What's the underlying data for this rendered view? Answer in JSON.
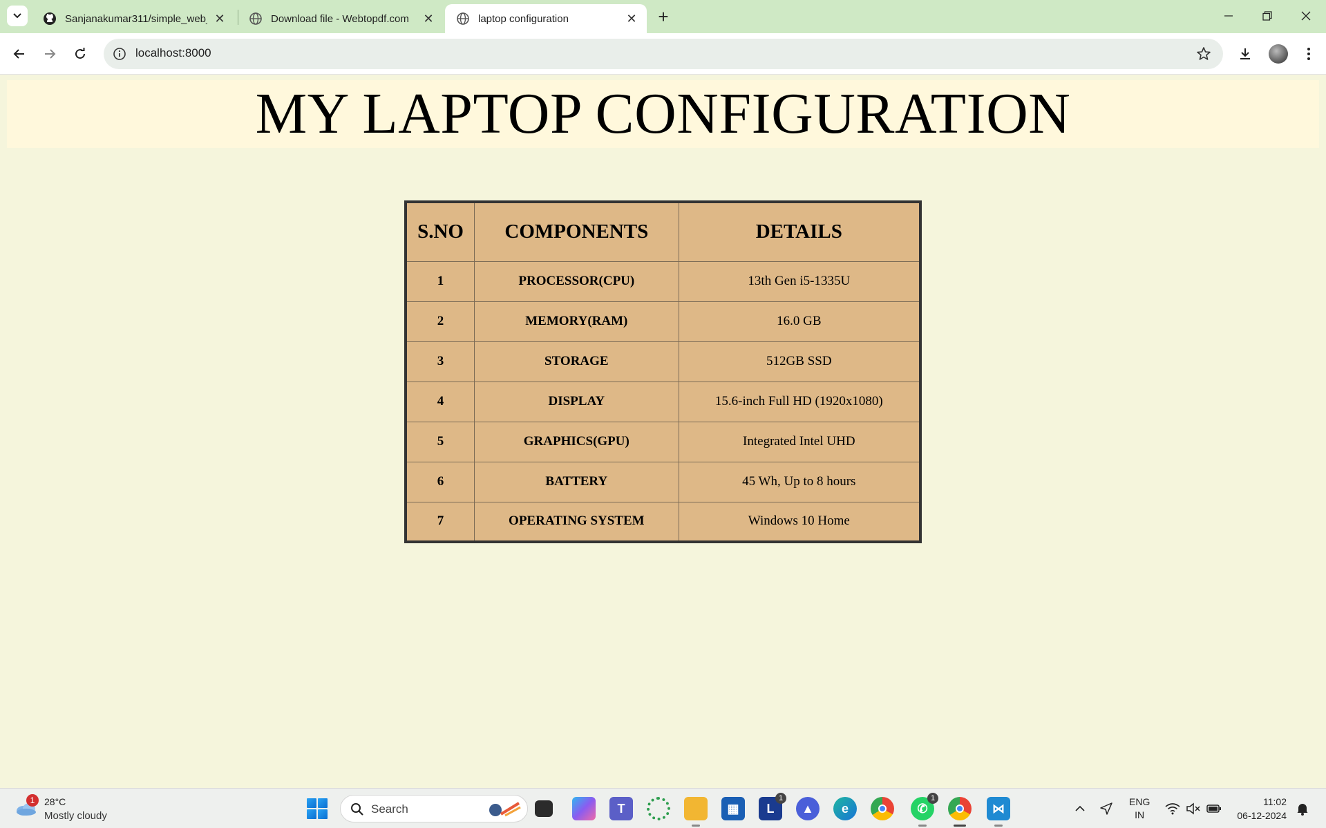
{
  "browser": {
    "tabs": [
      {
        "title": "Sanjanakumar311/simple_web_",
        "favicon": "github-icon"
      },
      {
        "title": "Download file - Webtopdf.com",
        "favicon": "globe-icon"
      },
      {
        "title": "laptop configuration",
        "favicon": "globe-icon",
        "active": true
      }
    ],
    "address": "localhost:8000"
  },
  "page": {
    "heading": "MY LAPTOP CONFIGURATION",
    "table": {
      "headers": [
        "S.NO",
        "COMPONENTS",
        "DETAILS"
      ],
      "rows": [
        {
          "sno": "1",
          "component": "PROCESSOR(CPU)",
          "details": "13th Gen i5-1335U"
        },
        {
          "sno": "2",
          "component": "MEMORY(RAM)",
          "details": "16.0 GB"
        },
        {
          "sno": "3",
          "component": "STORAGE",
          "details": "512GB SSD"
        },
        {
          "sno": "4",
          "component": "DISPLAY",
          "details": "15.6-inch Full HD (1920x1080)"
        },
        {
          "sno": "5",
          "component": "GRAPHICS(GPU)",
          "details": "Integrated Intel UHD"
        },
        {
          "sno": "6",
          "component": "BATTERY",
          "details": "45 Wh, Up to 8 hours"
        },
        {
          "sno": "7",
          "component": "OPERATING SYSTEM",
          "details": "Windows 10 Home"
        }
      ]
    }
  },
  "taskbar": {
    "weather": {
      "badge": "1",
      "temp": "28°C",
      "condition": "Mostly cloudy"
    },
    "search_label": "Search",
    "apps": [
      {
        "name": "task-view",
        "label": ""
      },
      {
        "name": "copilot",
        "label": ""
      },
      {
        "name": "teams",
        "label": ""
      },
      {
        "name": "loader-app",
        "label": ""
      },
      {
        "name": "file-explorer",
        "label": ""
      },
      {
        "name": "microsoft-store",
        "label": ""
      },
      {
        "name": "l-app",
        "label": "L",
        "count": "1"
      },
      {
        "name": "affinity-app",
        "label": ""
      },
      {
        "name": "edge",
        "label": ""
      },
      {
        "name": "chrome",
        "label": ""
      },
      {
        "name": "whatsapp",
        "label": "",
        "count": "1"
      },
      {
        "name": "chrome-profile",
        "label": ""
      },
      {
        "name": "vscode",
        "label": ""
      }
    ],
    "lang_top": "ENG",
    "lang_bottom": "IN",
    "time": "11:02",
    "date": "06-12-2024"
  },
  "colors": {
    "page_bg": "#f5f5dc",
    "banner_bg": "#fff8dc",
    "table_bg": "#deb887",
    "tabstrip_bg": "#cfe9c5"
  }
}
